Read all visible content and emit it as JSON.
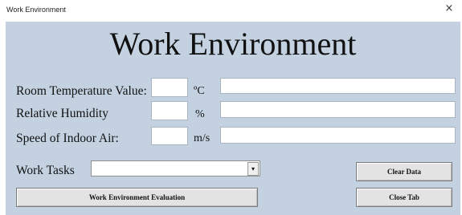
{
  "window": {
    "title": "Work Environment",
    "close_glyph": "×"
  },
  "heading": "Work Environment",
  "fields": {
    "temperature": {
      "label": "Room Temperature Value:",
      "unit": "ºC",
      "value": "",
      "result": ""
    },
    "humidity": {
      "label": "Relative Humidity",
      "unit": "%",
      "value": "",
      "result": ""
    },
    "air_speed": {
      "label": "Speed of Indoor Air:",
      "unit": "m/s",
      "value": "",
      "result": ""
    }
  },
  "work_tasks": {
    "label": "Work Tasks",
    "selected": "",
    "arrow_glyph": "▾"
  },
  "buttons": {
    "evaluate": "Work Environment Evaluation",
    "clear": "Clear Data",
    "close_tab": "Close Tab"
  }
}
